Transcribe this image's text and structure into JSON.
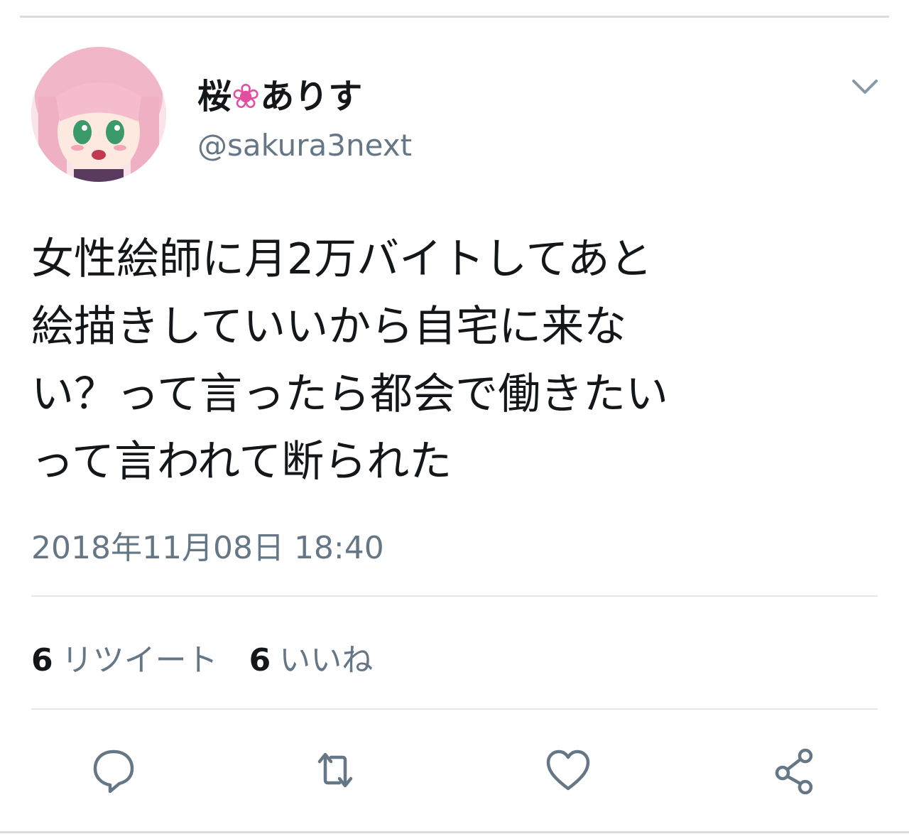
{
  "tweet": {
    "display_name_part1": "桜",
    "display_name_flower": "❀",
    "display_name_part2": "ありす",
    "username": "@sakura3next",
    "text_lines": [
      "女性絵師に月2万バイトしてあと",
      "絵描きしていいから自宅に来な",
      "い？って言ったら都会で働きたい",
      "って言われて断られた"
    ],
    "timestamp": "2018年11月08日 18:40",
    "retweet_count": "6",
    "retweet_label": "リツイート",
    "like_count": "6",
    "like_label": "いいね"
  },
  "icons": {
    "caret": "chevron-down-icon",
    "reply": "reply-bubble-icon",
    "retweet": "retweet-icon",
    "like": "heart-icon",
    "share": "share-icon"
  },
  "colors": {
    "text_primary": "#14171a",
    "text_secondary": "#657786",
    "icon_gray": "#657786",
    "divider": "#e1e8ed",
    "flower_pink": "#e24fa0"
  }
}
